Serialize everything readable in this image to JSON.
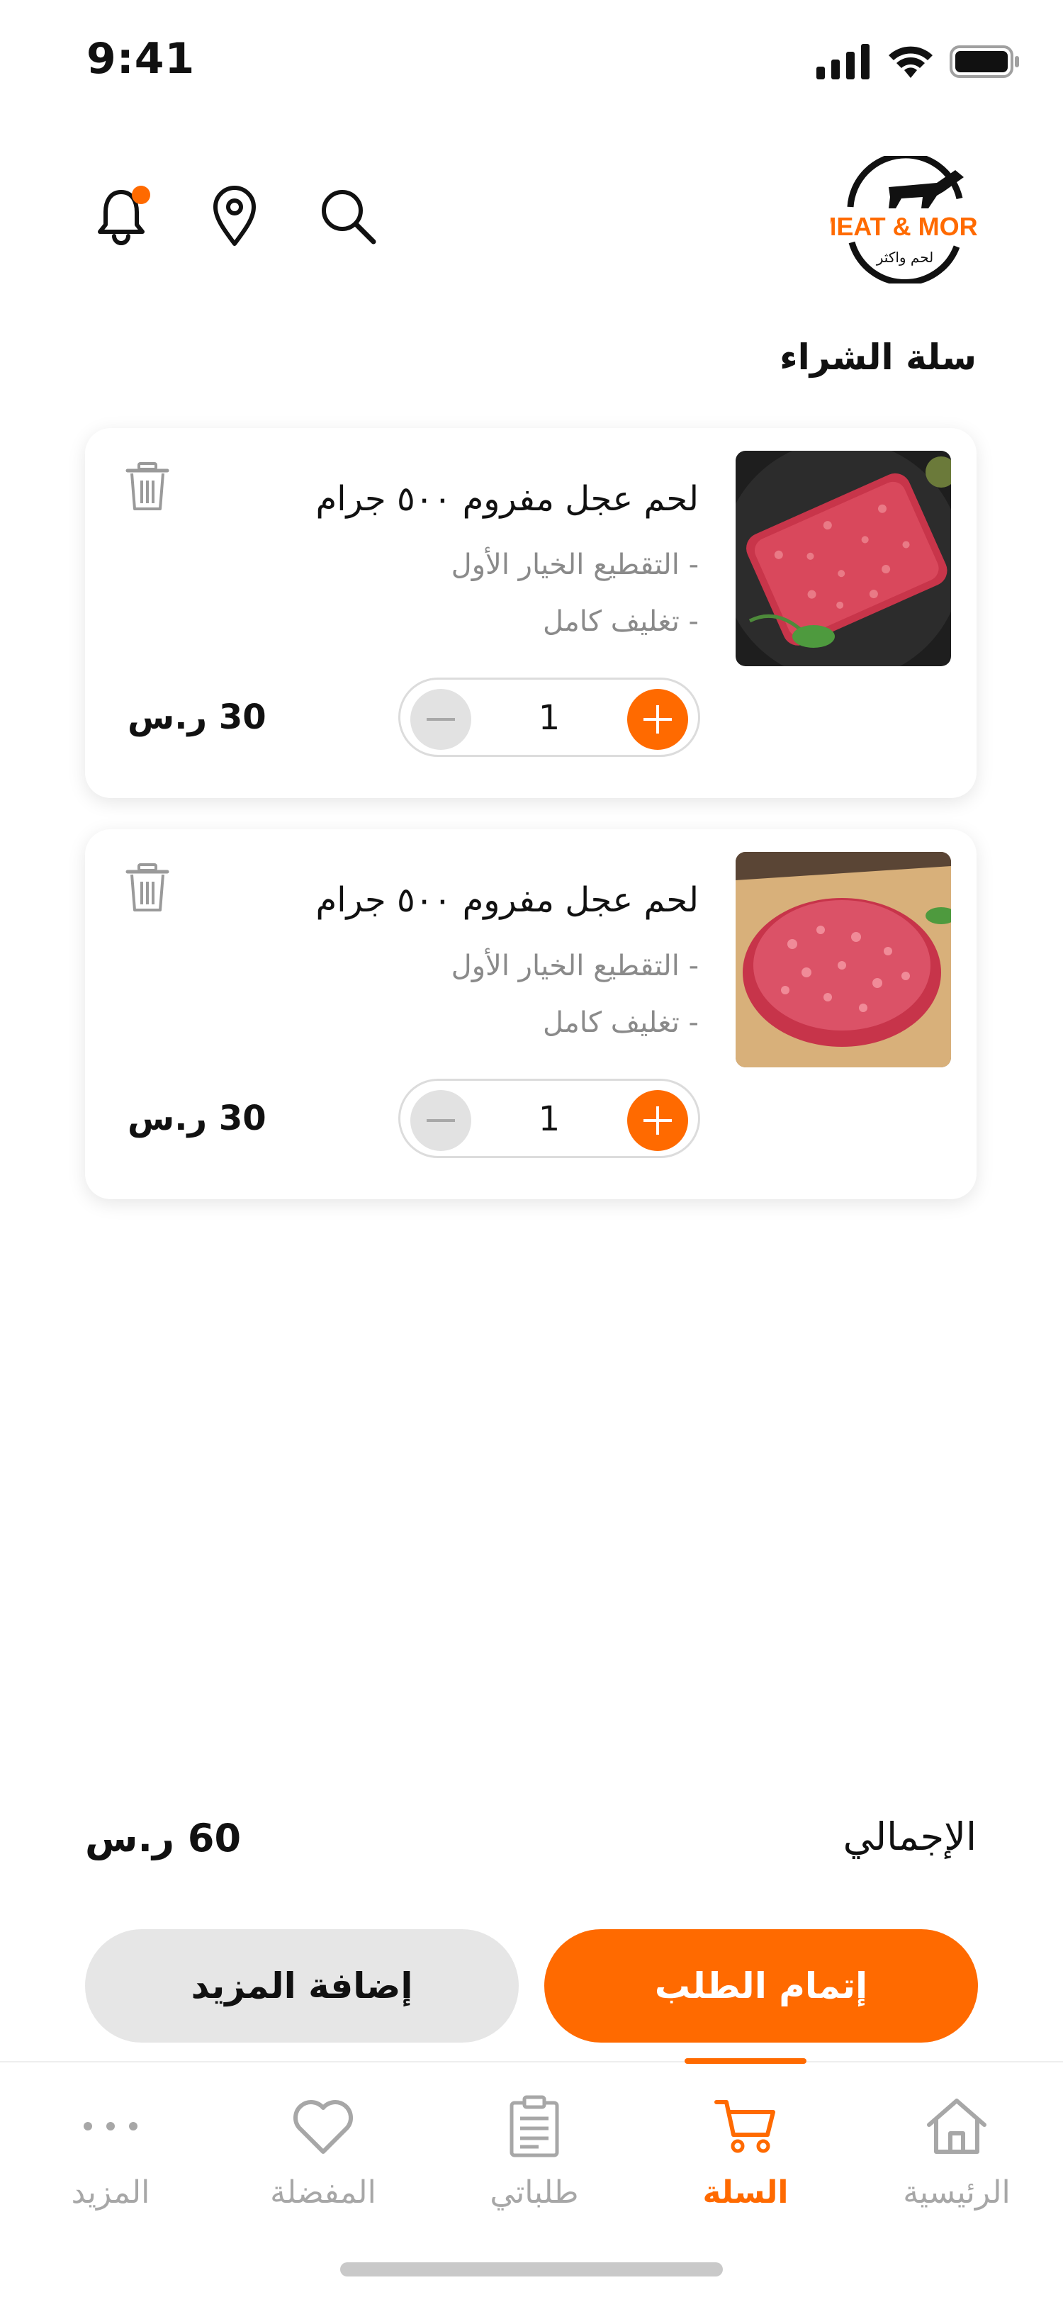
{
  "status_bar": {
    "time": "9:41"
  },
  "header": {
    "logo_text": "MEAT & MORE",
    "logo_subtext": "لحم واكثر"
  },
  "page_title": "سلة الشراء",
  "cart_items": [
    {
      "name": "لحم عجل مفروم ٥٠٠ جرام",
      "option_1": "- التقطيع الخيار الأول",
      "option_2": "- تغليف كامل",
      "quantity": "1",
      "price": "30 ر.س",
      "image": "minced-meat-on-plate"
    },
    {
      "name": "لحم عجل مفروم ٥٠٠ جرام",
      "option_1": "- التقطيع الخيار الأول",
      "option_2": "- تغليف كامل",
      "quantity": "1",
      "price": "30 ر.س",
      "image": "minced-meat-on-paper"
    }
  ],
  "total": {
    "label": "الإجمالي",
    "value": "60 ر.س"
  },
  "buttons": {
    "checkout": "إتمام الطلب",
    "add_more": "إضافة المزيد"
  },
  "bottom_nav": {
    "items": [
      {
        "label": "الرئيسية",
        "icon": "home-icon"
      },
      {
        "label": "السلة",
        "icon": "cart-icon",
        "active": true
      },
      {
        "label": "طلباتي",
        "icon": "orders-icon"
      },
      {
        "label": "المفضلة",
        "icon": "heart-icon"
      },
      {
        "label": "المزيد",
        "icon": "more-icon"
      }
    ]
  },
  "colors": {
    "accent": "#ff6a00",
    "muted": "#a7a7a7",
    "stepper_minus": "#e2e2e2"
  }
}
